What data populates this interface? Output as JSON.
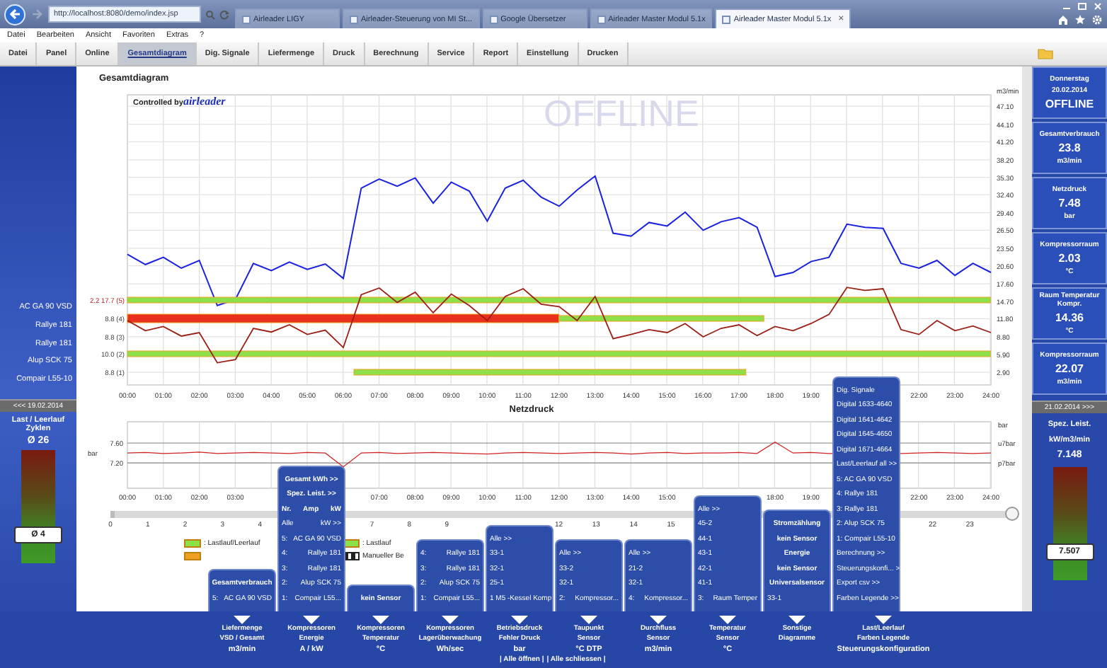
{
  "browser": {
    "address": "http://localhost:8080/demo/index.jsp",
    "close_glyph": "×",
    "tabs": [
      {
        "title": "Airleader LIGY",
        "selected": false
      },
      {
        "title": "Airleader-Steuerung von MI St...",
        "selected": false
      },
      {
        "title": "Google Übersetzer",
        "selected": false
      },
      {
        "title": "Airleader Master Modul 5.1x",
        "selected": false
      },
      {
        "title": "Airleader Master Modul 5.1x",
        "selected": true
      }
    ]
  },
  "menu": [
    "Datei",
    "Bearbeiten",
    "Ansicht",
    "Favoriten",
    "Extras",
    "?"
  ],
  "tabs": [
    {
      "label": "Datei",
      "selected": false
    },
    {
      "label": "Panel",
      "selected": false
    },
    {
      "label": "Online",
      "selected": false
    },
    {
      "label": "Gesamtdiagram",
      "selected": true
    },
    {
      "label": "Dig. Signale",
      "selected": false
    },
    {
      "label": "Liefermenge",
      "selected": false
    },
    {
      "label": "Druck",
      "selected": false
    },
    {
      "label": "Berechnung",
      "selected": false
    },
    {
      "label": "Service",
      "selected": false
    },
    {
      "label": "Report",
      "selected": false
    },
    {
      "label": "Einstellung",
      "selected": false
    },
    {
      "label": "Drucken",
      "selected": false
    }
  ],
  "left_panel": {
    "machines": [
      "AC GA 90 VSD",
      "Rallye 181",
      "Rallye 181",
      "Alup SCK 75",
      "Compair L55-10"
    ],
    "date_back": "<<< 19.02.2014",
    "cycles_title": "Last / Leerlauf Zyklen",
    "cycles_avg": "Ø 26",
    "gauge": {
      "level": 0.25,
      "reading": "Ø 4"
    }
  },
  "main_chart": {
    "brand_prefix": "Controlled by",
    "brand": "airleader",
    "status": "OFFLINE",
    "series_labels": [
      "2.2 17.7 (5)",
      "8.8 (4)",
      "8.8 (3)",
      "10.0 (2)",
      "8.8 (1)"
    ],
    "chart_data": {
      "type": "line",
      "title": "Gesamtdiagram",
      "ylabel": "m3/min",
      "xlim": [
        0,
        24
      ],
      "ylim": [
        0.8,
        49
      ],
      "x": [
        0,
        0.5,
        1,
        1.5,
        2,
        2.5,
        3,
        3.5,
        4,
        4.5,
        5,
        5.5,
        6,
        6.5,
        7,
        7.5,
        8,
        8.5,
        9,
        9.5,
        10,
        10.5,
        11,
        11.5,
        12,
        12.5,
        13,
        13.5,
        14,
        14.5,
        15,
        15.5,
        16,
        16.5,
        17,
        17.5,
        18,
        18.5,
        19,
        19.5,
        20,
        20.5,
        21,
        21.5,
        22,
        22.5,
        23,
        23.5,
        24
      ],
      "series": [
        {
          "color": "#1a22e0",
          "values": [
            22.5,
            20.8,
            22.0,
            20.2,
            21.5,
            14.0,
            15.0,
            21.0,
            19.8,
            21.2,
            20.0,
            20.9,
            18.5,
            33.5,
            35.0,
            33.8,
            35.2,
            31.0,
            34.5,
            33.0,
            28.0,
            33.5,
            34.8,
            32.0,
            30.5,
            33.2,
            35.5,
            26.0,
            25.5,
            27.8,
            27.2,
            29.5,
            26.5,
            27.9,
            28.6,
            27.0,
            18.8,
            19.5,
            21.3,
            22.0,
            27.5,
            27.0,
            26.8,
            21.0,
            20.2,
            21.5,
            19.0,
            21.0,
            19.5
          ]
        },
        {
          "color": "#9a1e14",
          "values": [
            11.5,
            9.8,
            10.5,
            8.9,
            9.5,
            4.5,
            5.0,
            10.2,
            9.6,
            10.8,
            9.2,
            9.9,
            7.0,
            15.8,
            16.9,
            14.5,
            16.2,
            12.8,
            15.9,
            14.0,
            11.5,
            15.5,
            16.8,
            14.2,
            13.8,
            11.5,
            15.5,
            8.5,
            9.2,
            10.0,
            9.5,
            11.0,
            8.8,
            10.2,
            10.8,
            9.0,
            10.5,
            9.8,
            11.0,
            12.5,
            17.0,
            16.5,
            16.8,
            10.0,
            9.2,
            11.5,
            9.8,
            10.6,
            9.5
          ]
        }
      ],
      "xticks": [
        {
          "value": 0,
          "label": "00:00"
        },
        {
          "value": 1,
          "label": "01:00"
        },
        {
          "value": 2,
          "label": "02:00"
        },
        {
          "value": 3,
          "label": "03:00"
        },
        {
          "value": 4,
          "label": "04:00"
        },
        {
          "value": 5,
          "label": "05:00"
        },
        {
          "value": 6,
          "label": "06:00"
        },
        {
          "value": 7,
          "label": "07:00"
        },
        {
          "value": 8,
          "label": "08:00"
        },
        {
          "value": 9,
          "label": "09:00"
        },
        {
          "value": 10,
          "label": "10:00"
        },
        {
          "value": 11,
          "label": "11:00"
        },
        {
          "value": 12,
          "label": "12:00"
        },
        {
          "value": 13,
          "label": "13:00"
        },
        {
          "value": 14,
          "label": "14:00"
        },
        {
          "value": 15,
          "label": "15:00"
        },
        {
          "value": 16,
          "label": "16:00"
        },
        {
          "value": 17,
          "label": "17:00"
        },
        {
          "value": 18,
          "label": "18:00"
        },
        {
          "value": 19,
          "label": "19:00"
        },
        {
          "value": 22,
          "label": "22:00"
        },
        {
          "value": 23,
          "label": "23:00"
        },
        {
          "value": 24,
          "label": "24:00"
        }
      ],
      "yticks": [
        {
          "value": 47.1,
          "label": "47.10"
        },
        {
          "value": 44.1,
          "label": "44.10"
        },
        {
          "value": 41.2,
          "label": "41.20"
        },
        {
          "value": 38.2,
          "label": "38.20"
        },
        {
          "value": 35.3,
          "label": "35.30"
        },
        {
          "value": 32.4,
          "label": "32.40"
        },
        {
          "value": 29.4,
          "label": "29.40"
        },
        {
          "value": 26.5,
          "label": "26.50"
        },
        {
          "value": 23.5,
          "label": "23.50"
        },
        {
          "value": 20.6,
          "label": "20.60"
        },
        {
          "value": 17.6,
          "label": "17.60"
        },
        {
          "value": 14.7,
          "label": "14.70"
        },
        {
          "value": 11.8,
          "label": "11.80"
        },
        {
          "value": 8.8,
          "label": "8.80"
        },
        {
          "value": 5.9,
          "label": "5.90"
        },
        {
          "value": 2.9,
          "label": "2.90"
        }
      ],
      "grid": true
    }
  },
  "pressure_chart": {
    "unit_right": "bar",
    "right_ticks": [
      "u7bar",
      "p7bar"
    ],
    "chart_data": {
      "type": "line",
      "title": "Netzdruck",
      "ylabel": "bar",
      "xlim": [
        0,
        24
      ],
      "ylim": [
        6.69,
        8.03
      ],
      "x": [
        0,
        0.5,
        1,
        1.5,
        2,
        2.5,
        3,
        3.5,
        4,
        4.5,
        5,
        5.5,
        6,
        6.5,
        7,
        7.5,
        8,
        8.5,
        9,
        9.5,
        10,
        10.5,
        11,
        11.5,
        12,
        12.5,
        13,
        13.5,
        14,
        14.5,
        15,
        15.5,
        16,
        16.5,
        17,
        17.5,
        18,
        18.5,
        19,
        19.5,
        21.5,
        22,
        22.5,
        23,
        23.5,
        24
      ],
      "series": [
        {
          "color": "#d02020",
          "values": [
            7.4,
            7.41,
            7.39,
            7.4,
            7.42,
            7.39,
            7.4,
            7.41,
            7.4,
            7.39,
            7.41,
            7.4,
            7.12,
            7.4,
            7.41,
            7.39,
            7.4,
            7.41,
            7.4,
            7.39,
            7.38,
            7.4,
            7.41,
            7.4,
            7.39,
            7.4,
            7.41,
            7.4,
            7.38,
            7.4,
            7.41,
            7.39,
            7.4,
            7.4,
            7.41,
            7.39,
            7.62,
            7.4,
            7.41,
            7.39,
            7.39,
            7.4,
            7.41,
            7.4,
            7.39,
            7.4
          ]
        }
      ],
      "xticks": [
        {
          "value": 0,
          "label": "00:00"
        },
        {
          "value": 1,
          "label": "01:00"
        },
        {
          "value": 2,
          "label": "02:00"
        },
        {
          "value": 3,
          "label": "03:00"
        },
        {
          "value": 7,
          "label": "07:00"
        },
        {
          "value": 8,
          "label": "08:00"
        },
        {
          "value": 9,
          "label": "09:00"
        },
        {
          "value": 10,
          "label": "10:00"
        },
        {
          "value": 11,
          "label": "11:00"
        },
        {
          "value": 12,
          "label": "12:00"
        },
        {
          "value": 13,
          "label": "13:00"
        },
        {
          "value": 14,
          "label": "14:00"
        },
        {
          "value": 15,
          "label": "15:00"
        },
        {
          "value": 18,
          "label": "18:00"
        },
        {
          "value": 19,
          "label": "19:00"
        },
        {
          "value": 22,
          "label": "22:00"
        },
        {
          "value": 23,
          "label": "23:00"
        },
        {
          "value": 24,
          "label": "24:00"
        }
      ],
      "yticks": [
        {
          "value": 7.6,
          "label": "7.60"
        },
        {
          "value": 7.2,
          "label": "7.20"
        }
      ],
      "grid": true
    }
  },
  "day_slider": {
    "level": 1,
    "ticks": [
      "0",
      "1",
      "2",
      "3",
      "4",
      "7",
      "8",
      "9",
      "12",
      "13",
      "14",
      "15",
      "22",
      "23"
    ]
  },
  "legend": [
    {
      "kind": "bar",
      "color": "#8ee04a",
      "label": ": Lastlauf/Leerlauf"
    },
    {
      "kind": "bar",
      "color": "#8ee04a",
      "label": ": Lastlauf"
    },
    {
      "kind": "bar",
      "color": "#f0a020"
    },
    {
      "kind": "manual",
      "label": "Manueller Be"
    }
  ],
  "menus": [
    {
      "rows": [
        {
          "kind": "header",
          "cells": [
            "Gesamtverbrauch"
          ]
        },
        {
          "kind": "item",
          "cells": [
            "5:",
            "AC GA 90 VSD"
          ]
        }
      ]
    },
    {
      "rows": [
        {
          "kind": "header",
          "cells": [
            "Gesamt kWh >>"
          ]
        },
        {
          "kind": "header",
          "cells": [
            "Spez. Leist. >>"
          ]
        },
        {
          "kind": "header",
          "cells": [
            "Nr.",
            "Amp",
            "kW"
          ]
        },
        {
          "kind": "item",
          "cells": [
            "Alle",
            "kW >>"
          ]
        },
        {
          "kind": "item",
          "cells": [
            "5:",
            "AC GA 90 VSD"
          ]
        },
        {
          "kind": "item",
          "cells": [
            "4:",
            "Rallye 181"
          ]
        },
        {
          "kind": "item",
          "cells": [
            "3:",
            "Rallye 181"
          ]
        },
        {
          "kind": "item",
          "cells": [
            "2:",
            "Alup SCK 75"
          ]
        },
        {
          "kind": "item",
          "cells": [
            "1:",
            "Compair L55..."
          ]
        }
      ]
    },
    {
      "rows": [
        {
          "kind": "header",
          "cells": [
            "kein Sensor"
          ]
        }
      ]
    },
    {
      "rows": [
        {
          "kind": "item",
          "cells": [
            "4:",
            "Rallye 181"
          ]
        },
        {
          "kind": "item",
          "cells": [
            "3:",
            "Rallye 181"
          ]
        },
        {
          "kind": "item",
          "cells": [
            "2:",
            "Alup SCK 75"
          ]
        },
        {
          "kind": "item",
          "cells": [
            "1:",
            "Compair L55..."
          ]
        }
      ]
    },
    {
      "rows": [
        {
          "kind": "item",
          "cells": [
            "Alle >>"
          ]
        },
        {
          "kind": "item",
          "cells": [
            "33-1"
          ]
        },
        {
          "kind": "item",
          "cells": [
            "32-1"
          ]
        },
        {
          "kind": "item",
          "cells": [
            "25-1"
          ]
        },
        {
          "kind": "item",
          "cells": [
            "1 M5 -",
            "Kessel Komp"
          ]
        }
      ]
    },
    {
      "rows": [
        {
          "kind": "item",
          "cells": [
            "Alle >>"
          ]
        },
        {
          "kind": "item",
          "cells": [
            "33-2"
          ]
        },
        {
          "kind": "item",
          "cells": [
            "32-1"
          ]
        },
        {
          "kind": "item",
          "cells": [
            "2:",
            "Kompressor..."
          ]
        }
      ]
    },
    {
      "rows": [
        {
          "kind": "item",
          "cells": [
            "Alle >>"
          ]
        },
        {
          "kind": "item",
          "cells": [
            "21-2"
          ]
        },
        {
          "kind": "item",
          "cells": [
            "32-1"
          ]
        },
        {
          "kind": "item",
          "cells": [
            "4:",
            "Kompressor..."
          ]
        }
      ]
    },
    {
      "rows": [
        {
          "kind": "item",
          "cells": [
            "Alle >>"
          ]
        },
        {
          "kind": "item",
          "cells": [
            "45-2"
          ]
        },
        {
          "kind": "item",
          "cells": [
            "44-1"
          ]
        },
        {
          "kind": "item",
          "cells": [
            "43-1"
          ]
        },
        {
          "kind": "item",
          "cells": [
            "42-1"
          ]
        },
        {
          "kind": "item",
          "cells": [
            "41-1"
          ]
        },
        {
          "kind": "item",
          "cells": [
            "3:",
            "Raum Temper"
          ]
        }
      ]
    },
    {
      "rows": [
        {
          "kind": "header",
          "cells": [
            "Stromzählung"
          ]
        },
        {
          "kind": "header",
          "cells": [
            "kein Sensor"
          ]
        },
        {
          "kind": "header",
          "cells": [
            "Energie"
          ]
        },
        {
          "kind": "header",
          "cells": [
            "kein Sensor"
          ]
        },
        {
          "kind": "header",
          "cells": [
            "Universalsensor"
          ]
        },
        {
          "kind": "item",
          "cells": [
            "33-1"
          ]
        }
      ]
    },
    {
      "rows": [
        {
          "kind": "item",
          "cells": [
            "Dig. Signale"
          ]
        },
        {
          "kind": "item",
          "cells": [
            "Digital 1633-4640"
          ]
        },
        {
          "kind": "item",
          "cells": [
            "Digital 1641-4642"
          ]
        },
        {
          "kind": "item",
          "cells": [
            "Digital 1645-4650"
          ]
        },
        {
          "kind": "item",
          "cells": [
            "Digital 1671-4664"
          ]
        },
        {
          "kind": "item",
          "cells": [
            "Last/Leerlauf all >>"
          ]
        },
        {
          "kind": "item",
          "cells": [
            "5: AC GA 90 VSD"
          ]
        },
        {
          "kind": "item",
          "cells": [
            "4: Rallye 181"
          ]
        },
        {
          "kind": "item",
          "cells": [
            "3: Rallye 181"
          ]
        },
        {
          "kind": "item",
          "cells": [
            "2: Alup SCK 75"
          ]
        },
        {
          "kind": "item",
          "cells": [
            "1: Compair L55-10"
          ]
        },
        {
          "kind": "item",
          "cells": [
            "Berechnung >>"
          ]
        },
        {
          "kind": "item",
          "cells": [
            "Steuerungskonfi... >>"
          ]
        },
        {
          "kind": "item",
          "cells": [
            "Export csv >>"
          ]
        },
        {
          "kind": "item",
          "cells": [
            "Farben Legende >>"
          ]
        }
      ]
    }
  ],
  "bottom_menu": [
    [
      "Liefermenge",
      "VSD / Gesamt",
      "m3/min"
    ],
    [
      "Kompressoren",
      "Energie",
      "A / kW"
    ],
    [
      "Kompressoren",
      "Temperatur",
      "°C"
    ],
    [
      "Kompressoren",
      "Lagerüberwachung",
      "Wh/sec"
    ],
    [
      "Betriebsdruck",
      "Fehler Druck",
      "bar"
    ],
    [
      "Taupunkt",
      "Sensor",
      "°C DTP"
    ],
    [
      "Durchfluss",
      "Sensor",
      "m3/min"
    ],
    [
      "Temperatur",
      "Sensor",
      "°C"
    ],
    [
      "Sonstige",
      "Diagramme"
    ],
    [
      "Last/Leerlauf",
      "Farben Legende",
      "Steuerungskonfiguration"
    ]
  ],
  "bottom_links": [
    "| Alle öffnen |",
    "| Alle schliessen |"
  ],
  "right_panel": {
    "day": "Donnerstag",
    "date": "20.02.2014",
    "state": "OFFLINE",
    "readings": [
      {
        "label": "Gesamtverbrauch",
        "value": "23.8",
        "unit": "m3/min"
      },
      {
        "label": "Netzdruck",
        "value": "7.48",
        "unit": "bar"
      },
      {
        "label": "Kompressorraum",
        "value": "2.03",
        "unit": "°C"
      },
      {
        "label": "Raum Temperatur Kompr.",
        "value": "14.36",
        "unit": "°C"
      },
      {
        "label": "Kompressorraum",
        "value": "22.07",
        "unit": "m3/min"
      }
    ],
    "date_forward": "21.02.2014 >>>",
    "spec_title": "Spez. Leist.",
    "spec_unit": "kW/m3/min",
    "spec_value": "7.148",
    "gauge": {
      "level": 0.25,
      "reading": "7.507"
    }
  }
}
